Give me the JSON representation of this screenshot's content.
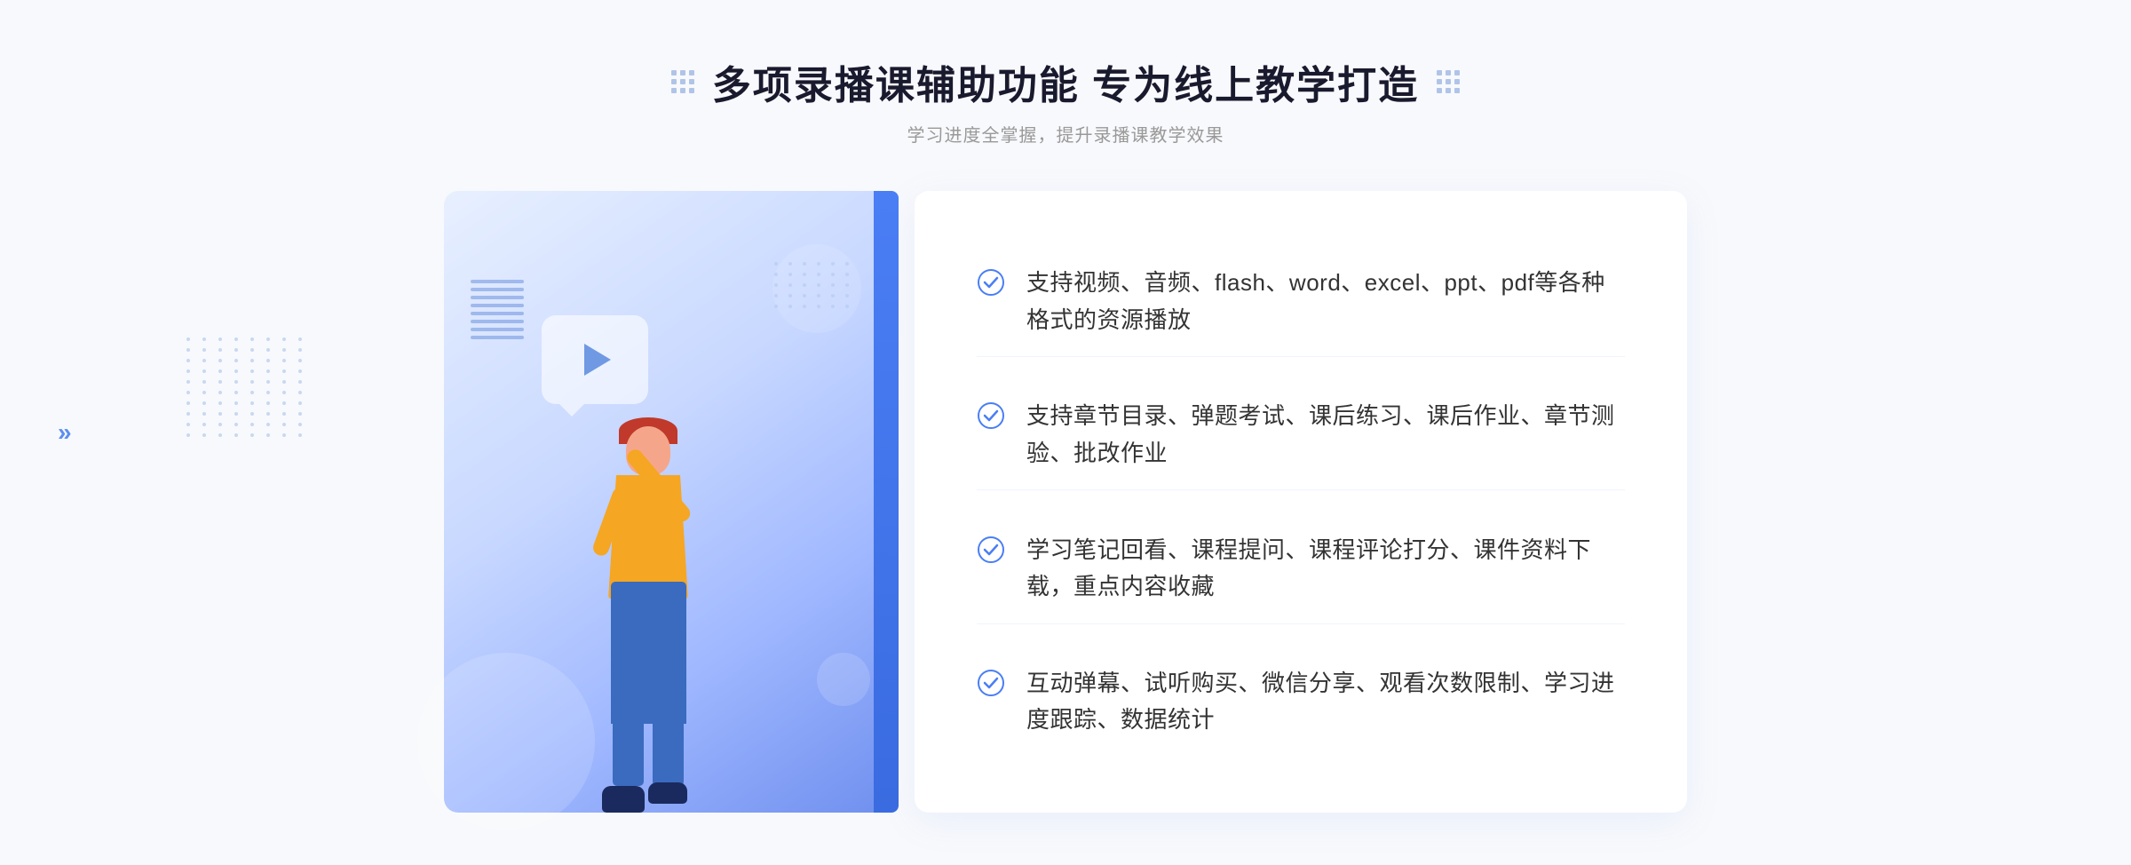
{
  "header": {
    "main_title": "多项录播课辅助功能 专为线上教学打造",
    "sub_title": "学习进度全掌握，提升录播课教学效果"
  },
  "features": [
    {
      "id": 1,
      "text": "支持视频、音频、flash、word、excel、ppt、pdf等各种格式的资源播放"
    },
    {
      "id": 2,
      "text": "支持章节目录、弹题考试、课后练习、课后作业、章节测验、批改作业"
    },
    {
      "id": 3,
      "text": "学习笔记回看、课程提问、课程评论打分、课件资料下载，重点内容收藏"
    },
    {
      "id": 4,
      "text": "互动弹幕、试听购买、微信分享、观看次数限制、学习进度跟踪、数据统计"
    }
  ],
  "colors": {
    "primary_blue": "#4a7ef5",
    "light_blue": "#7aa3f8",
    "check_blue": "#4a7ef5",
    "text_dark": "#333333",
    "text_light": "#999999",
    "bg_light": "#f8f9fc"
  },
  "icons": {
    "check_circle": "check-circle",
    "play": "play-icon",
    "grid_left": "grid-decorator-left",
    "grid_right": "grid-decorator-right",
    "double_arrow": "double-arrow-left"
  }
}
